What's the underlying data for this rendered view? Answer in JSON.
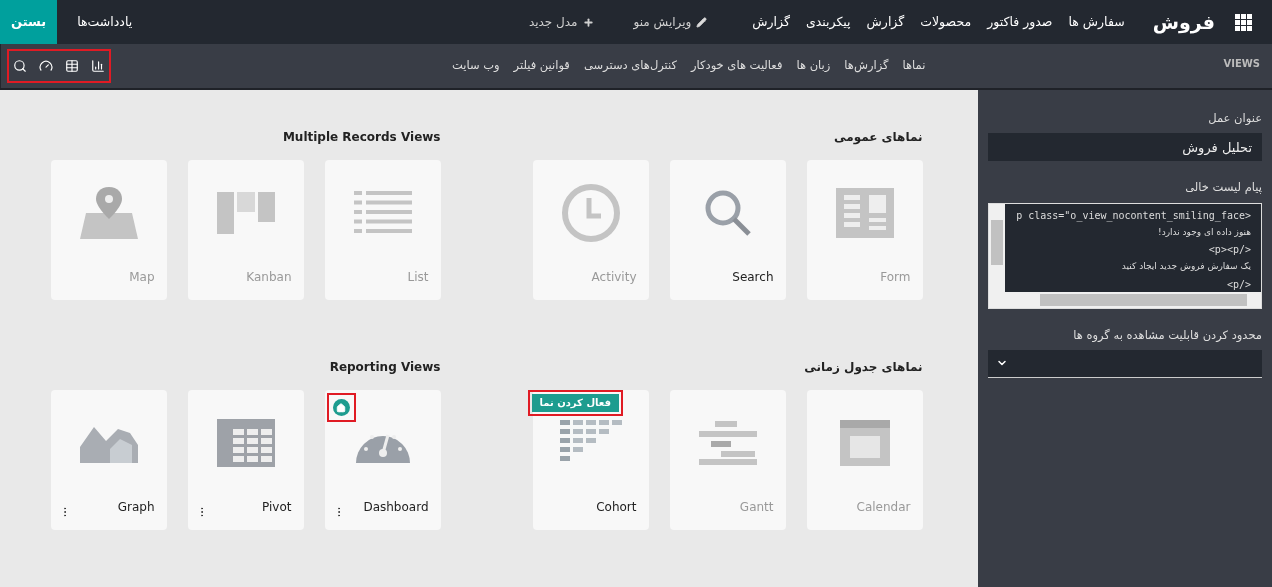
{
  "top_bar": {
    "brand": "فروش",
    "menu": [
      "سفارش ها",
      "صدور فاکتور",
      "محصولات",
      "گزارش",
      "پیکربندی",
      "گزارش"
    ],
    "actions": [
      {
        "kind": "edit",
        "label": "ویرایش منو"
      },
      {
        "kind": "new",
        "label": "مدل جدید"
      }
    ],
    "notes": "یادداشت‌ها",
    "close": "بستن"
  },
  "sub_bar": {
    "title": "VIEWS",
    "tabs": [
      "نماها",
      "گزارش‌ها",
      "زبان ها",
      "فعالیت های خودکار",
      "کنترل‌های دسترسی",
      "قوانین فیلتر",
      "وب سایت"
    ],
    "toolbar_highlighted": true
  },
  "sections": [
    {
      "title": "نماهای عمومی",
      "cards": [
        {
          "kind": "form",
          "label": "Form",
          "active": false
        },
        {
          "kind": "search",
          "label": "Search",
          "active": true
        },
        {
          "kind": "activity",
          "label": "Activity",
          "active": false
        }
      ]
    },
    {
      "title": "Multiple Records Views",
      "cards": [
        {
          "kind": "list",
          "label": "List",
          "active": false
        },
        {
          "kind": "kanban",
          "label": "Kanban",
          "active": false
        },
        {
          "kind": "map",
          "label": "Map",
          "active": false
        }
      ]
    },
    {
      "title": "نماهای جدول زمانی",
      "cards": [
        {
          "kind": "calendar",
          "label": "Calendar",
          "active": false
        },
        {
          "kind": "gantt",
          "label": "Gantt",
          "active": false
        },
        {
          "kind": "cohort",
          "label": "Cohort",
          "active": true,
          "action": {
            "label": "فعال کردن نما",
            "highlighted": true
          }
        }
      ]
    },
    {
      "title": "Reporting Views",
      "cards": [
        {
          "kind": "dashboard",
          "label": "Dashboard",
          "active": true,
          "menu": true,
          "default": true,
          "default_highlighted": true
        },
        {
          "kind": "pivot",
          "label": "Pivot",
          "active": true,
          "menu": true
        },
        {
          "kind": "graph",
          "label": "Graph",
          "active": true,
          "menu": true
        }
      ]
    }
  ],
  "sidebar": {
    "fields": [
      {
        "kind": "text",
        "label": "عنوان عمل",
        "value": "تحلیل فروش"
      },
      {
        "kind": "code",
        "label": "پیام لیست خالی",
        "lines": [
          {
            "kind": "code",
            "text": "p class=\"o_view_nocontent_smiling_face>"
          },
          {
            "kind": "text",
            "text": "هنوز داده ای وجود ندارد!"
          },
          {
            "kind": "code",
            "text": "<p><p/>"
          },
          {
            "kind": "text",
            "text": "یک سفارش فروش جدید ایجاد کنید"
          },
          {
            "kind": "code",
            "text": "<p/>"
          }
        ]
      },
      {
        "kind": "select",
        "label": "محدود کردن قابلیت مشاهده به گروه ها"
      }
    ]
  }
}
